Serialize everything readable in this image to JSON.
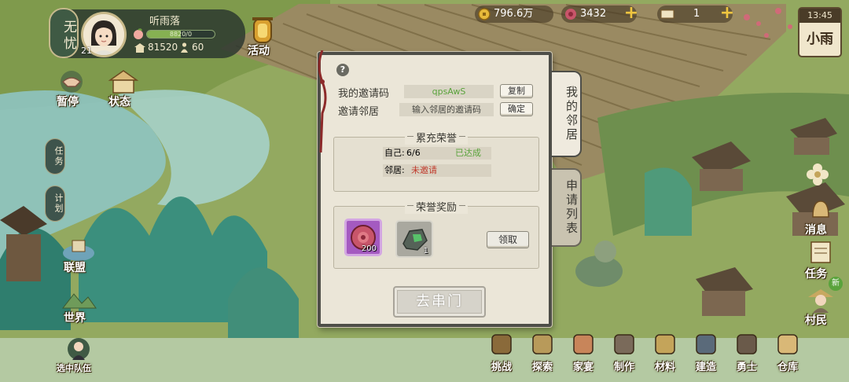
{
  "player": {
    "mood": "无忧",
    "name": "听雨落",
    "level": "21",
    "exp_text": "8820/0",
    "exp_fraction": 0.5,
    "power": "81520",
    "population": "60"
  },
  "activity_button": {
    "label": "活动"
  },
  "resources": {
    "coins": "796.6万",
    "gems": "3432",
    "tickets": "1"
  },
  "weather": {
    "time": "13:45",
    "condition": "小雨"
  },
  "left_menu": {
    "pause": "暂停",
    "status": "状态",
    "tasks_tag": "任务",
    "plan_tag": "计划",
    "alliance": "联盟",
    "world": "世界",
    "team": "选中队伍"
  },
  "right_menu": {
    "messages": "消息",
    "tasks": "任务",
    "villagers": "村民",
    "new_badge": "新"
  },
  "bottom_menu": [
    {
      "label": "挑战",
      "icon": "challenge-icon"
    },
    {
      "label": "探索",
      "icon": "explore-icon"
    },
    {
      "label": "家宴",
      "icon": "feast-icon"
    },
    {
      "label": "制作",
      "icon": "craft-icon"
    },
    {
      "label": "材料",
      "icon": "materials-icon"
    },
    {
      "label": "建造",
      "icon": "build-icon"
    },
    {
      "label": "勇士",
      "icon": "warrior-icon"
    },
    {
      "label": "仓库",
      "icon": "warehouse-icon"
    }
  ],
  "dialog": {
    "invite_code_label": "我的邀请码",
    "invite_code_value": "qpsAwS",
    "copy_button": "复制",
    "invite_neighbor_label": "邀请邻居",
    "invite_input_placeholder": "输入邻居的邀请码",
    "confirm_button": "确定",
    "honor_title": "累充荣誉",
    "self_label": "自己:",
    "self_value": "6/6",
    "self_status": "已达成",
    "neighbor_label": "邻居:",
    "neighbor_status": "未邀请",
    "reward_title": "荣誉奖励",
    "rewards": [
      {
        "name": "rose-token",
        "count": "200"
      },
      {
        "name": "jade-stone",
        "count": "1"
      }
    ],
    "claim_button": "领取",
    "visit_button": "去串门"
  },
  "tabs": {
    "my_neighbors": "我的邻居",
    "application_list": "申请列表"
  },
  "colors": {
    "accent_green": "#5aa33c",
    "alert_red": "#c0392b",
    "dialog_bg": "#ebe6d8",
    "gold": "#f0c640"
  }
}
